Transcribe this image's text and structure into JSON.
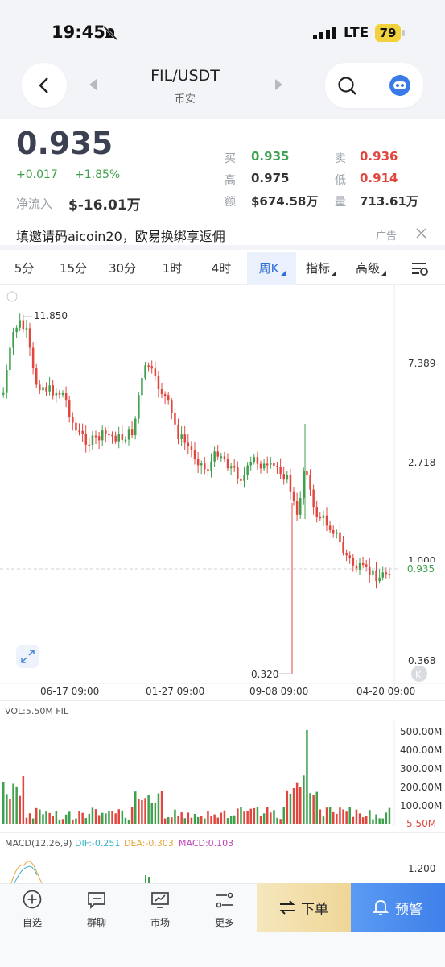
{
  "status_bar": {
    "time": "19:45",
    "network": "LTE",
    "battery": "79"
  },
  "header": {
    "pair": "FIL/USDT",
    "exchange": "币安"
  },
  "quote": {
    "price": "0.935",
    "change": "+0.017",
    "change_pct": "+1.85%",
    "netflow_label": "净流入",
    "netflow_value": "$-16.01万",
    "buy_label": "买",
    "buy_value": "0.935",
    "sell_label": "卖",
    "sell_value": "0.936",
    "high_label": "高",
    "high_value": "0.975",
    "low_label": "低",
    "low_value": "0.914",
    "amount_label": "额",
    "amount_value": "$674.58万",
    "volume_label": "量",
    "volume_value": "713.61万"
  },
  "ad": {
    "text": "填邀请码aicoin20，欧易换绑享返佣",
    "tag": "广告"
  },
  "intervals": [
    "5分",
    "15分",
    "30分",
    "1时",
    "4时",
    "周K",
    "指标",
    "高级"
  ],
  "active_interval": "周K",
  "chart": {
    "y_labels": [
      "7.389",
      "2.718",
      "1.000",
      "0.368"
    ],
    "current_price": "0.935",
    "max_label": "11.850",
    "min_label": "0.320",
    "x_labels": [
      "06-17 09:00",
      "01-27 09:00",
      "09-08 09:00",
      "04-20 09:00"
    ]
  },
  "volume": {
    "title": "VOL:5.50M FIL",
    "y_labels": [
      "500.00M",
      "400.00M",
      "300.00M",
      "200.00M",
      "100.00M"
    ],
    "current": "5.50M"
  },
  "macd": {
    "title": "MACD(12,26,9)",
    "dif": "DIF:-0.251",
    "dea": "DEA:-0.303",
    "macd": "MACD:0.103",
    "y_label": "1.200"
  },
  "bottom_nav": {
    "items": [
      "自选",
      "群聊",
      "市场",
      "更多"
    ],
    "order_label": "下单",
    "alert_label": "预警"
  },
  "colors": {
    "up": "#3fa14e",
    "down": "#e2473f",
    "accent": "#2f6fd6",
    "order_bg": "#f3e0a9",
    "alert_bg": "#4a8cf0"
  }
}
